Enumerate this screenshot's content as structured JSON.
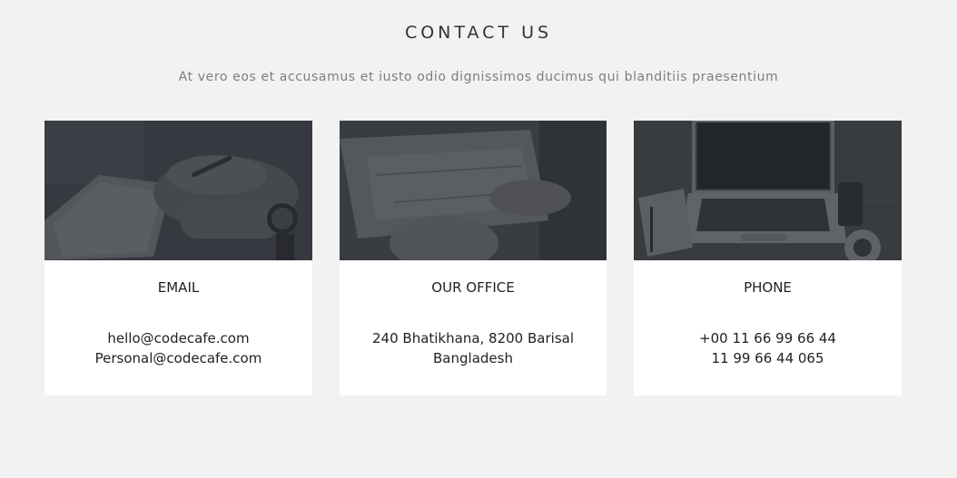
{
  "section": {
    "title": "CONTACT US",
    "subtitle": "At vero eos et accusamus et iusto odio dignissimos ducimus qui blanditiis praesentium"
  },
  "cards": [
    {
      "image": "hands-writing-notebook-photo",
      "title": "EMAIL",
      "lines": [
        "hello@codecafe.com",
        "Personal@codecafe.com"
      ]
    },
    {
      "image": "hands-holding-map-photo",
      "title": "OUR OFFICE",
      "lines": [
        "240 Bhatikhana, 8200 Barisal",
        "Bangladesh"
      ]
    },
    {
      "image": "laptop-on-desk-photo",
      "title": "PHONE",
      "lines": [
        "+00 11 66 99 66 44",
        "11 99 66 44 065"
      ]
    }
  ],
  "colors": {
    "background": "#f2f2f2",
    "card": "#ffffff",
    "image_overlay": "#262a30",
    "heading": "#333333",
    "subtitle": "#7b7e85"
  }
}
